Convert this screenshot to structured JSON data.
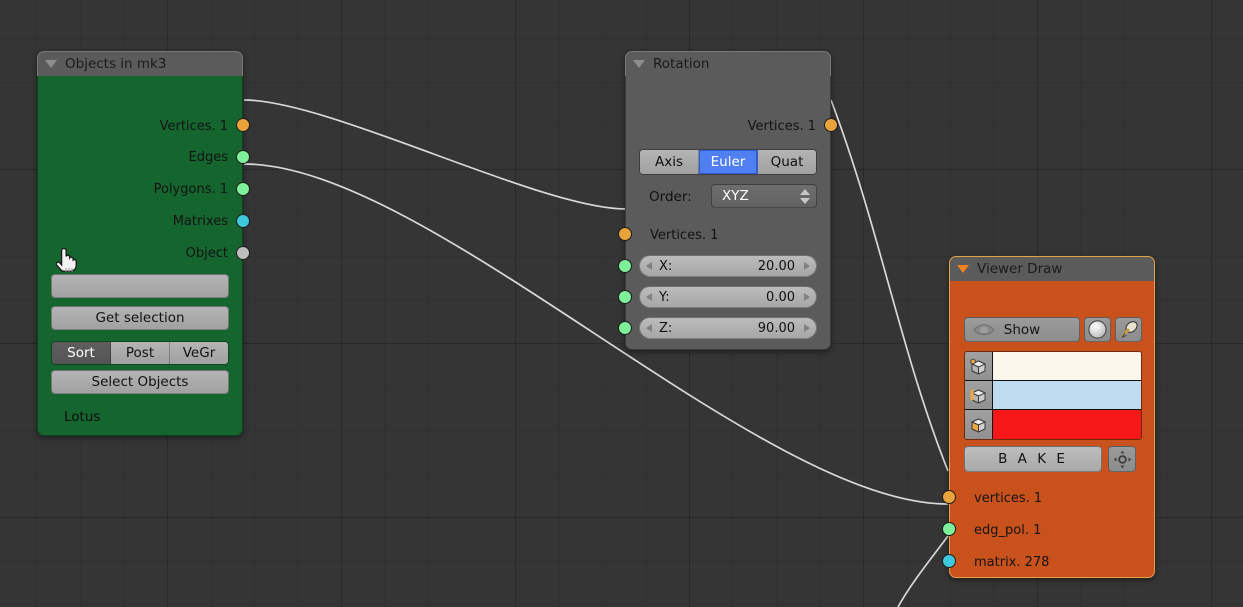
{
  "editor": {
    "background_color": "#353535",
    "link_color": "#d8d8d8"
  },
  "nodes": [
    {
      "id": "objects",
      "title": "Objects in mk3",
      "header_icon": "collapse-triangle-icon",
      "body_color": "#15652f",
      "outputs": [
        {
          "label": "Vertices. 1",
          "color": "#e8a33a"
        },
        {
          "label": "Edges",
          "color": "#7ef09a"
        },
        {
          "label": "Polygons. 1",
          "color": "#7ef09a"
        },
        {
          "label": "Matrixes",
          "color": "#3ec8dc"
        },
        {
          "label": "Object",
          "color": "#bdbdbd"
        }
      ],
      "text_field_value": "",
      "get_selection_label": "Get selection",
      "mode_segments": [
        {
          "label": "Sort",
          "active": true
        },
        {
          "label": "Post",
          "active": false
        },
        {
          "label": "VeGr",
          "active": false
        }
      ],
      "select_objects_label": "Select Objects",
      "footer_text": "Lotus"
    },
    {
      "id": "rotation",
      "title": "Rotation",
      "header_icon": "collapse-triangle-icon",
      "body_color": "#5b5b5b",
      "output_label": "Vertices. 1",
      "output_color": "#e8a33a",
      "mode_segments": [
        {
          "label": "Axis",
          "active": false
        },
        {
          "label": "Euler",
          "active": true
        },
        {
          "label": "Quat",
          "active": false
        }
      ],
      "order_label": "Order:",
      "order_value": "XYZ",
      "input_label": "Vertices. 1",
      "input_color": "#e8a33a",
      "fields": [
        {
          "label": "X:",
          "value": "20.00",
          "socket_color": "#7ef09a"
        },
        {
          "label": "Y:",
          "value": "0.00",
          "socket_color": "#7ef09a"
        },
        {
          "label": "Z:",
          "value": "90.00",
          "socket_color": "#7ef09a"
        }
      ]
    },
    {
      "id": "viewer",
      "title": "Viewer Draw",
      "header_icon": "collapse-triangle-icon",
      "body_color": "#c9511b",
      "show_label": "Show",
      "show_toggle_icon": "eye-icon",
      "sphere_icon": "sphere-shading-icon",
      "dropper_icon": "eyedropper-icon",
      "swatches": [
        {
          "icon": "vertex-cube-icon",
          "color": "#faf6ec"
        },
        {
          "icon": "edge-cube-icon",
          "color": "#bddcf0"
        },
        {
          "icon": "face-cube-icon",
          "color": "#f61818"
        }
      ],
      "bake_label": "B A K E",
      "target_icon": "target-icon",
      "inputs": [
        {
          "label": "vertices. 1",
          "color": "#e8a33a"
        },
        {
          "label": "edg_pol. 1",
          "color": "#7ef09a"
        },
        {
          "label": "matrix. 278",
          "color": "#3ec8dc"
        }
      ]
    }
  ],
  "cursor": {
    "icon": "hand-pointer-cursor"
  }
}
